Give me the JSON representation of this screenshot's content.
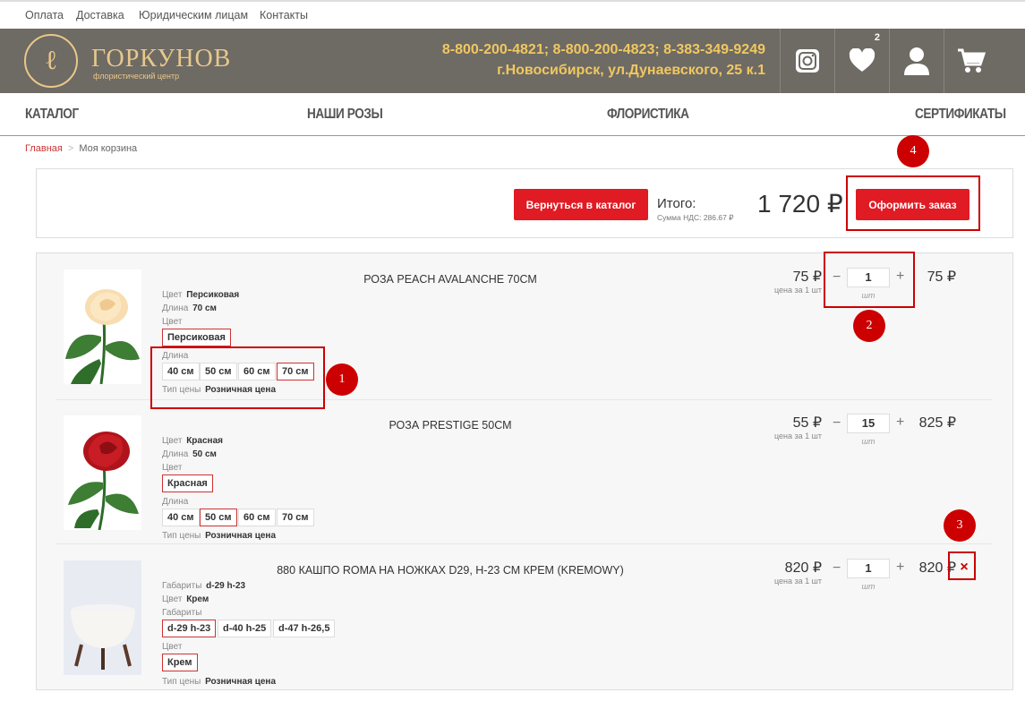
{
  "topbar": {
    "links": [
      "Оплата",
      "Доставка",
      "Юридическим лицам",
      "Контакты"
    ]
  },
  "header": {
    "logo_letter": "ℓ",
    "brand": "ГОРКУНОВ",
    "brand_sub": "флористический центр",
    "phones": "8-800-200-4821; 8-800-200-4823; 8-383-349-9249",
    "address": "г.Новосибирск, ул.Дунаевского, 25 к.1",
    "fav_count": "2",
    "colors": {
      "header_bg": "#6e6a64",
      "accent": "#f0c860",
      "logo": "#e8c88a"
    }
  },
  "nav": [
    "КАТАЛОГ",
    "НАШИ РОЗЫ",
    "ФЛОРИСТИКА",
    "СЕРТИФИКАТЫ"
  ],
  "breadcrumb": {
    "home": "Главная",
    "sep": ">",
    "current": "Моя корзина"
  },
  "summary": {
    "back_label": "Вернуться в каталог",
    "total_label": "Итого:",
    "vat": "Сумма НДС: 286.67 ₽",
    "total": "1 720 ₽",
    "order_label": "Оформить заказ"
  },
  "items": [
    {
      "name": "РОЗА PEACH AVALANCHE 70СМ",
      "props": [
        [
          "Цвет",
          "Персиковая"
        ],
        [
          "Длина",
          "70 см"
        ]
      ],
      "color_label": "Цвет",
      "color_opt": "Персиковая",
      "length_label": "Длина",
      "length_opts": [
        "40 см",
        "50 см",
        "60 см",
        "70 см"
      ],
      "price_type_label": "Тип цены",
      "price_type": "Розничная цена",
      "price": "75 ₽",
      "price_note": "цена за 1 шт",
      "qty": "1",
      "unit": "шт",
      "sum": "75 ₽"
    },
    {
      "name": "РОЗА PRESTIGE 50СМ",
      "props": [
        [
          "Цвет",
          "Красная"
        ],
        [
          "Длина",
          "50 см"
        ]
      ],
      "color_label": "Цвет",
      "color_opt": "Красная",
      "length_label": "Длина",
      "length_opts": [
        "40 см",
        "50 см",
        "60 см",
        "70 см"
      ],
      "price_type_label": "Тип цены",
      "price_type": "Розничная цена",
      "price": "55 ₽",
      "price_note": "цена за 1 шт",
      "qty": "15",
      "unit": "шт",
      "sum": "825 ₽"
    },
    {
      "name": "880 КАШПО ROMA НА НОЖКАХ D29, H-23 СМ КРЕМ (KREMOWY)",
      "props": [
        [
          "Габариты",
          "d-29 h-23"
        ],
        [
          "Цвет",
          "Крем"
        ]
      ],
      "dim_label": "Габариты",
      "dim_opts": [
        "d-29 h-23",
        "d-40 h-25",
        "d-47 h-26,5"
      ],
      "color_label": "Цвет",
      "color_opt": "Крем",
      "price_type_label": "Тип цены",
      "price_type": "Розничная цена",
      "price": "820 ₽",
      "price_note": "цена за 1 шт",
      "qty": "1",
      "unit": "шт",
      "sum": "820 ₽",
      "remove": "×"
    }
  ],
  "qty_controls": {
    "minus": "−",
    "plus": "+"
  },
  "annotations": [
    "1",
    "2",
    "3",
    "4"
  ]
}
